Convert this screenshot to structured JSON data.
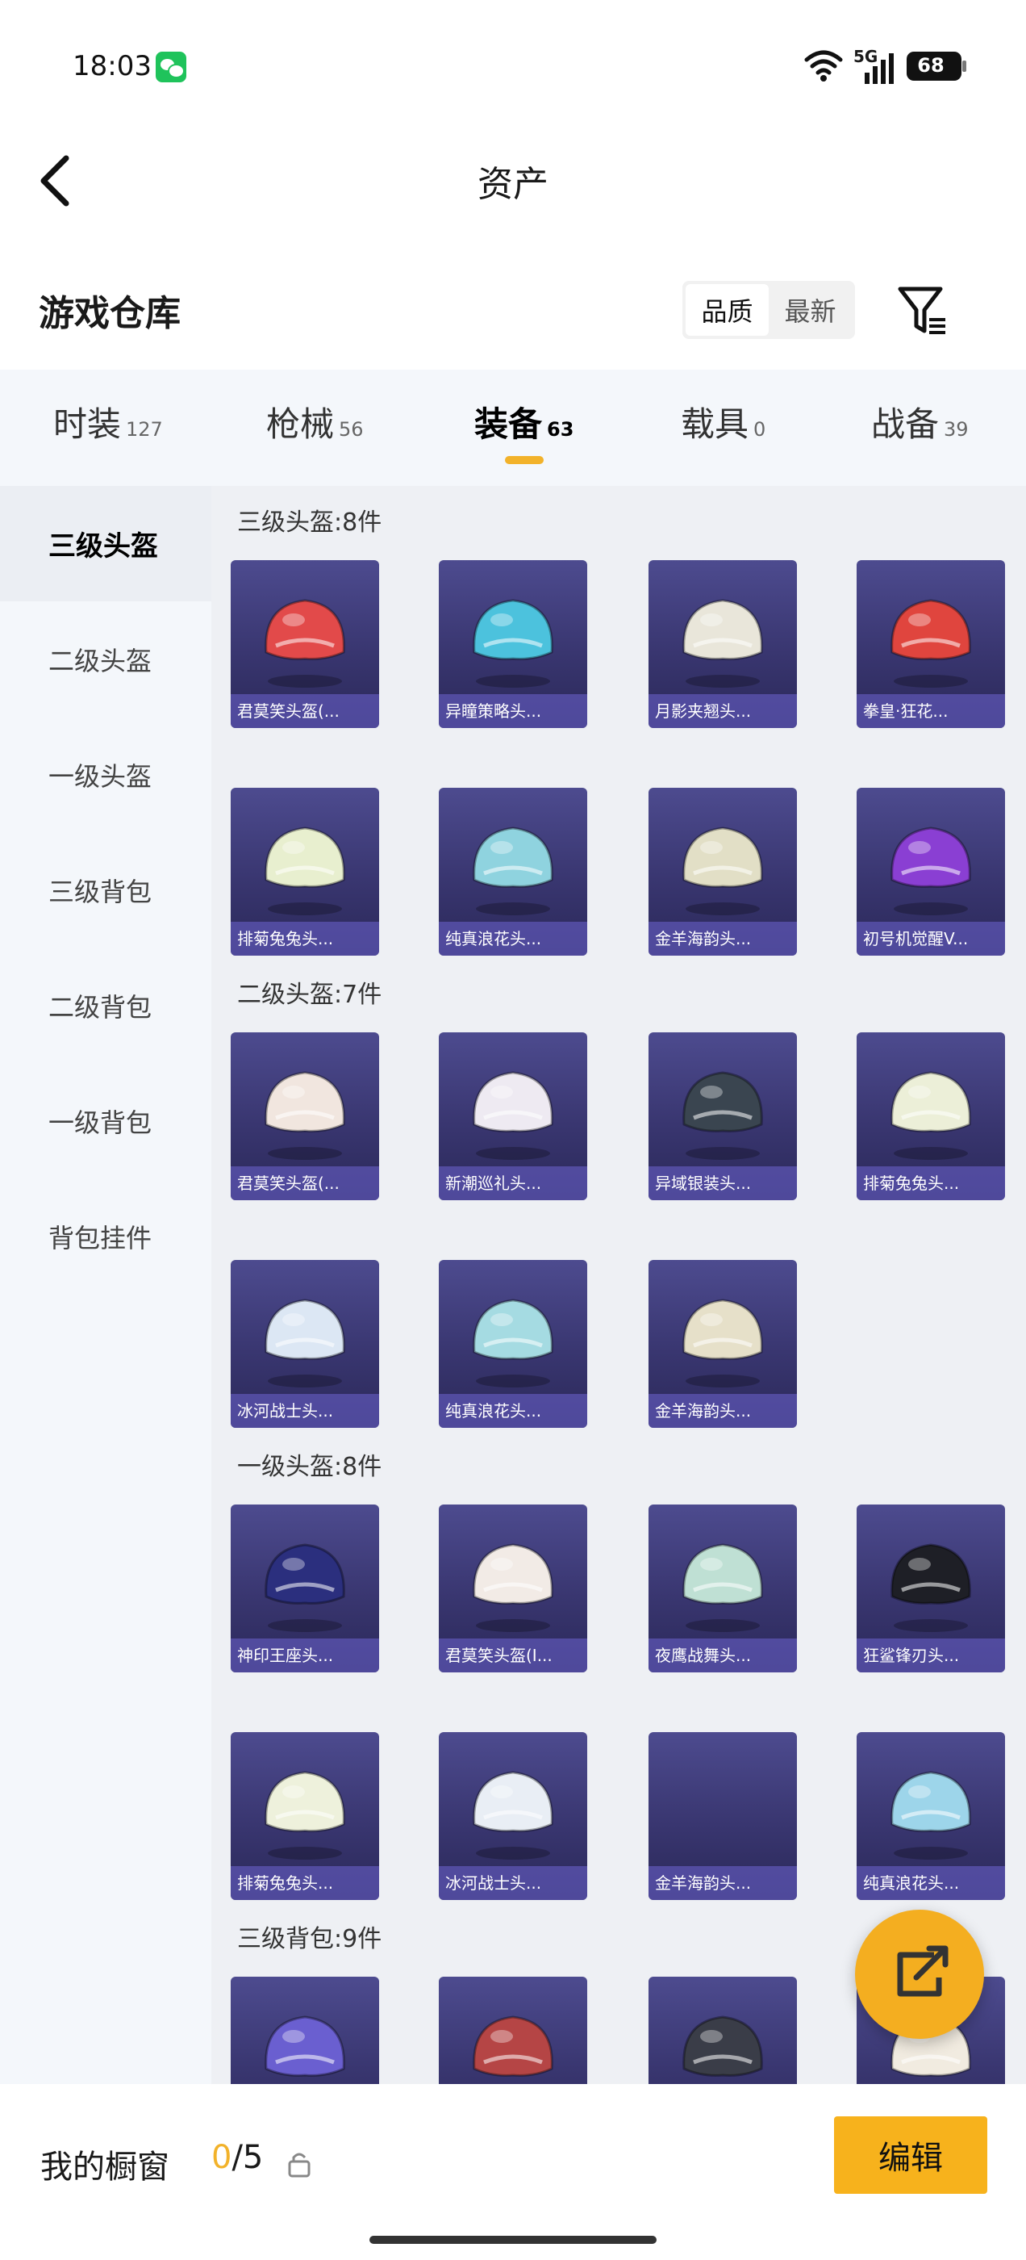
{
  "status": {
    "time": "18:03",
    "network": "5G",
    "battery": "68"
  },
  "nav": {
    "title": "资产"
  },
  "header": {
    "title": "游戏仓库",
    "sort_options": [
      "品质",
      "最新"
    ]
  },
  "tabs": [
    {
      "label": "时装",
      "count": "127"
    },
    {
      "label": "枪械",
      "count": "56"
    },
    {
      "label": "装备",
      "count": "63",
      "active": true
    },
    {
      "label": "载具",
      "count": "0"
    },
    {
      "label": "战备",
      "count": "39"
    }
  ],
  "sidebar": [
    {
      "label": "三级头盔",
      "active": true
    },
    {
      "label": "二级头盔"
    },
    {
      "label": "一级头盔"
    },
    {
      "label": "三级背包"
    },
    {
      "label": "二级背包"
    },
    {
      "label": "一级背包"
    },
    {
      "label": "背包挂件"
    }
  ],
  "sections": [
    {
      "title": "三级头盔:8件",
      "items": [
        {
          "name": "君莫笑头盔(...",
          "color": "#e24a4a"
        },
        {
          "name": "异瞳策略头...",
          "color": "#4cc2dd"
        },
        {
          "name": "月影夹翘头...",
          "color": "#e9e6da"
        },
        {
          "name": "拳皇·狂花...",
          "color": "#e0453e"
        },
        {
          "name": "排菊兔兔头...",
          "color": "#e8efcf"
        },
        {
          "name": "纯真浪花头...",
          "color": "#8fd3df"
        },
        {
          "name": "金羊海韵头...",
          "color": "#e2dfc6"
        },
        {
          "name": "初号机觉醒V...",
          "color": "#8a3fd3"
        }
      ]
    },
    {
      "title": "二级头盔:7件",
      "items": [
        {
          "name": "君莫笑头盔(...",
          "color": "#f1e6df"
        },
        {
          "name": "新潮巡礼头...",
          "color": "#eeeaf2"
        },
        {
          "name": "异域银装头...",
          "color": "#3a4550"
        },
        {
          "name": "排菊兔兔头...",
          "color": "#ecefd8"
        },
        {
          "name": "冰河战士头...",
          "color": "#dce7f4"
        },
        {
          "name": "纯真浪花头...",
          "color": "#a5dbe2"
        },
        {
          "name": "金羊海韵头...",
          "color": "#e6e0c9"
        }
      ]
    },
    {
      "title": "一级头盔:8件",
      "items": [
        {
          "name": "神印王座头...",
          "color": "#2b2f7e"
        },
        {
          "name": "君莫笑头盔(I...",
          "color": "#f2ebe6"
        },
        {
          "name": "夜鹰战舞头...",
          "color": "#bfe0d4"
        },
        {
          "name": "狂鲨锋刃头...",
          "color": "#1e1f26"
        },
        {
          "name": "排菊兔兔头...",
          "color": "#eef1dc"
        },
        {
          "name": "冰河战士头...",
          "color": "#e9eef5"
        },
        {
          "name": "金羊海韵头...",
          "color": ""
        },
        {
          "name": "纯真浪花头...",
          "color": "#9dd5ea"
        }
      ]
    },
    {
      "title": "三级背包:9件",
      "items": [
        {
          "name": "",
          "color": "#6a5fd0"
        },
        {
          "name": "",
          "color": "#b54545"
        },
        {
          "name": "",
          "color": "#3a3d48"
        },
        {
          "name": "",
          "color": "#f1ebe0"
        }
      ]
    }
  ],
  "bottom": {
    "showcase_label": "我的橱窗",
    "count_current": "0",
    "count_total": "/5",
    "edit_label": "编辑"
  },
  "colors": {
    "accent": "#f2b22a",
    "card_bg": "#3d3a78"
  }
}
